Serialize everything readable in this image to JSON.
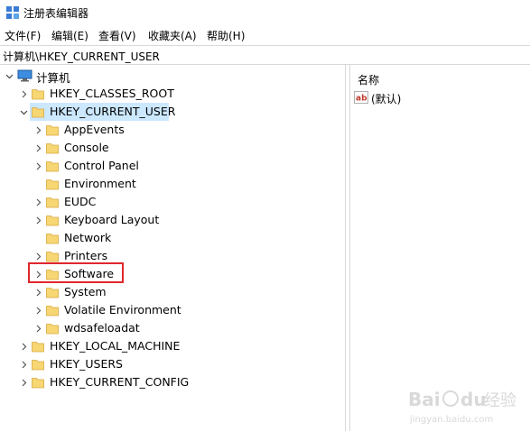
{
  "window": {
    "title": "注册表编辑器"
  },
  "menu": [
    "文件(F)",
    "编辑(E)",
    "查看(V)",
    "收藏夹(A)",
    "帮助(H)"
  ],
  "address": "计算机\\HKEY_CURRENT_USER",
  "tree": {
    "root": "计算机",
    "hives": [
      "HKEY_CLASSES_ROOT",
      "HKEY_CURRENT_USER",
      "HKEY_LOCAL_MACHINE",
      "HKEY_USERS",
      "HKEY_CURRENT_CONFIG"
    ],
    "hkcu_children": [
      "AppEvents",
      "Console",
      "Control Panel",
      "Environment",
      "EUDC",
      "Keyboard Layout",
      "Network",
      "Printers",
      "Software",
      "System",
      "Volatile Environment",
      "wdsafeloadat"
    ]
  },
  "list": {
    "column_name": "名称",
    "values": [
      "(默认)"
    ]
  },
  "watermark": {
    "brand": "Baidu",
    "brand_cn": "经验",
    "url": "jingyan.baidu.com"
  },
  "colors": {
    "selection": "#cce8ff",
    "highlight_box": "#e0262d",
    "folder": "#f7d674"
  }
}
